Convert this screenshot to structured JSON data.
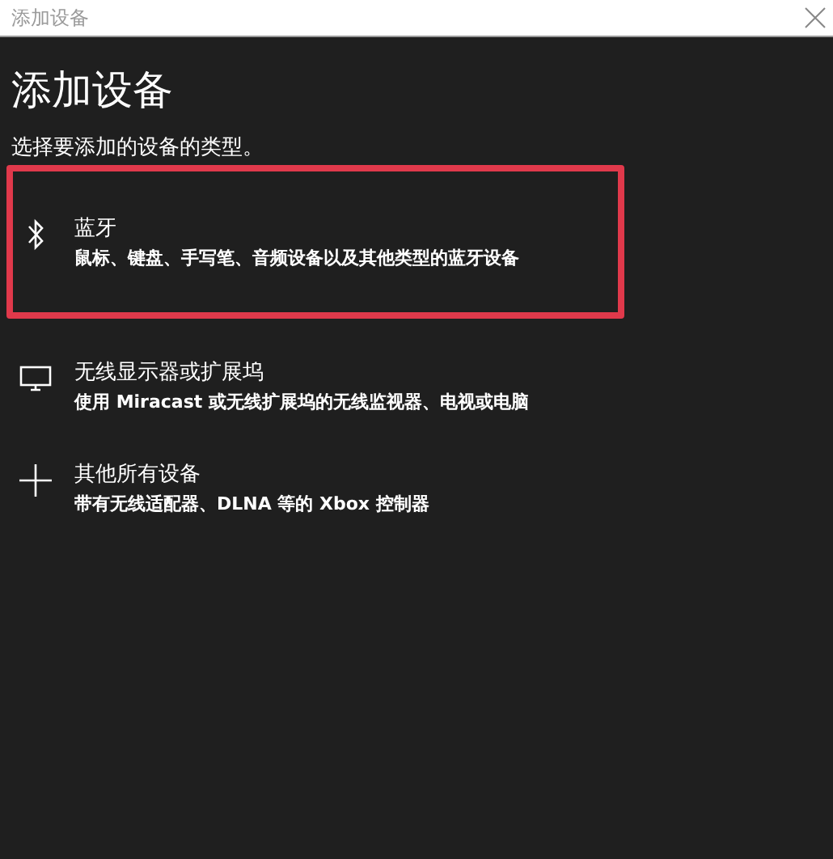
{
  "window": {
    "title": "添加设备"
  },
  "heading": "添加设备",
  "subtitle": "选择要添加的设备的类型。",
  "options": [
    {
      "kind": "bluetooth",
      "label": "蓝牙",
      "description": "鼠标、键盘、手写笔、音频设备以及其他类型的蓝牙设备",
      "selected": true
    },
    {
      "kind": "display",
      "label": "无线显示器或扩展坞",
      "description": "使用 Miracast 或无线扩展坞的无线监视器、电视或电脑",
      "selected": false
    },
    {
      "kind": "other",
      "label": "其他所有设备",
      "description": "带有无线适配器、DLNA 等的 Xbox 控制器",
      "selected": false
    }
  ]
}
